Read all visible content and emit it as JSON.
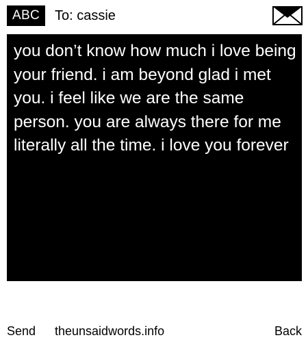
{
  "header": {
    "input_mode": "ABC",
    "recipient": "To: cassie",
    "icon": "envelope-icon"
  },
  "message": {
    "body": "you don’t know how much i love being your friend. i am beyond glad i met you. i feel like we are the same person. you are always there for me literally all the time. i love you forever"
  },
  "footer": {
    "send_label": "Send",
    "site_label": "theunsaidwords.info",
    "back_label": "Back"
  },
  "colors": {
    "background": "#ffffff",
    "message_background": "#000000",
    "message_text": "#ffffff",
    "text": "#000000"
  }
}
